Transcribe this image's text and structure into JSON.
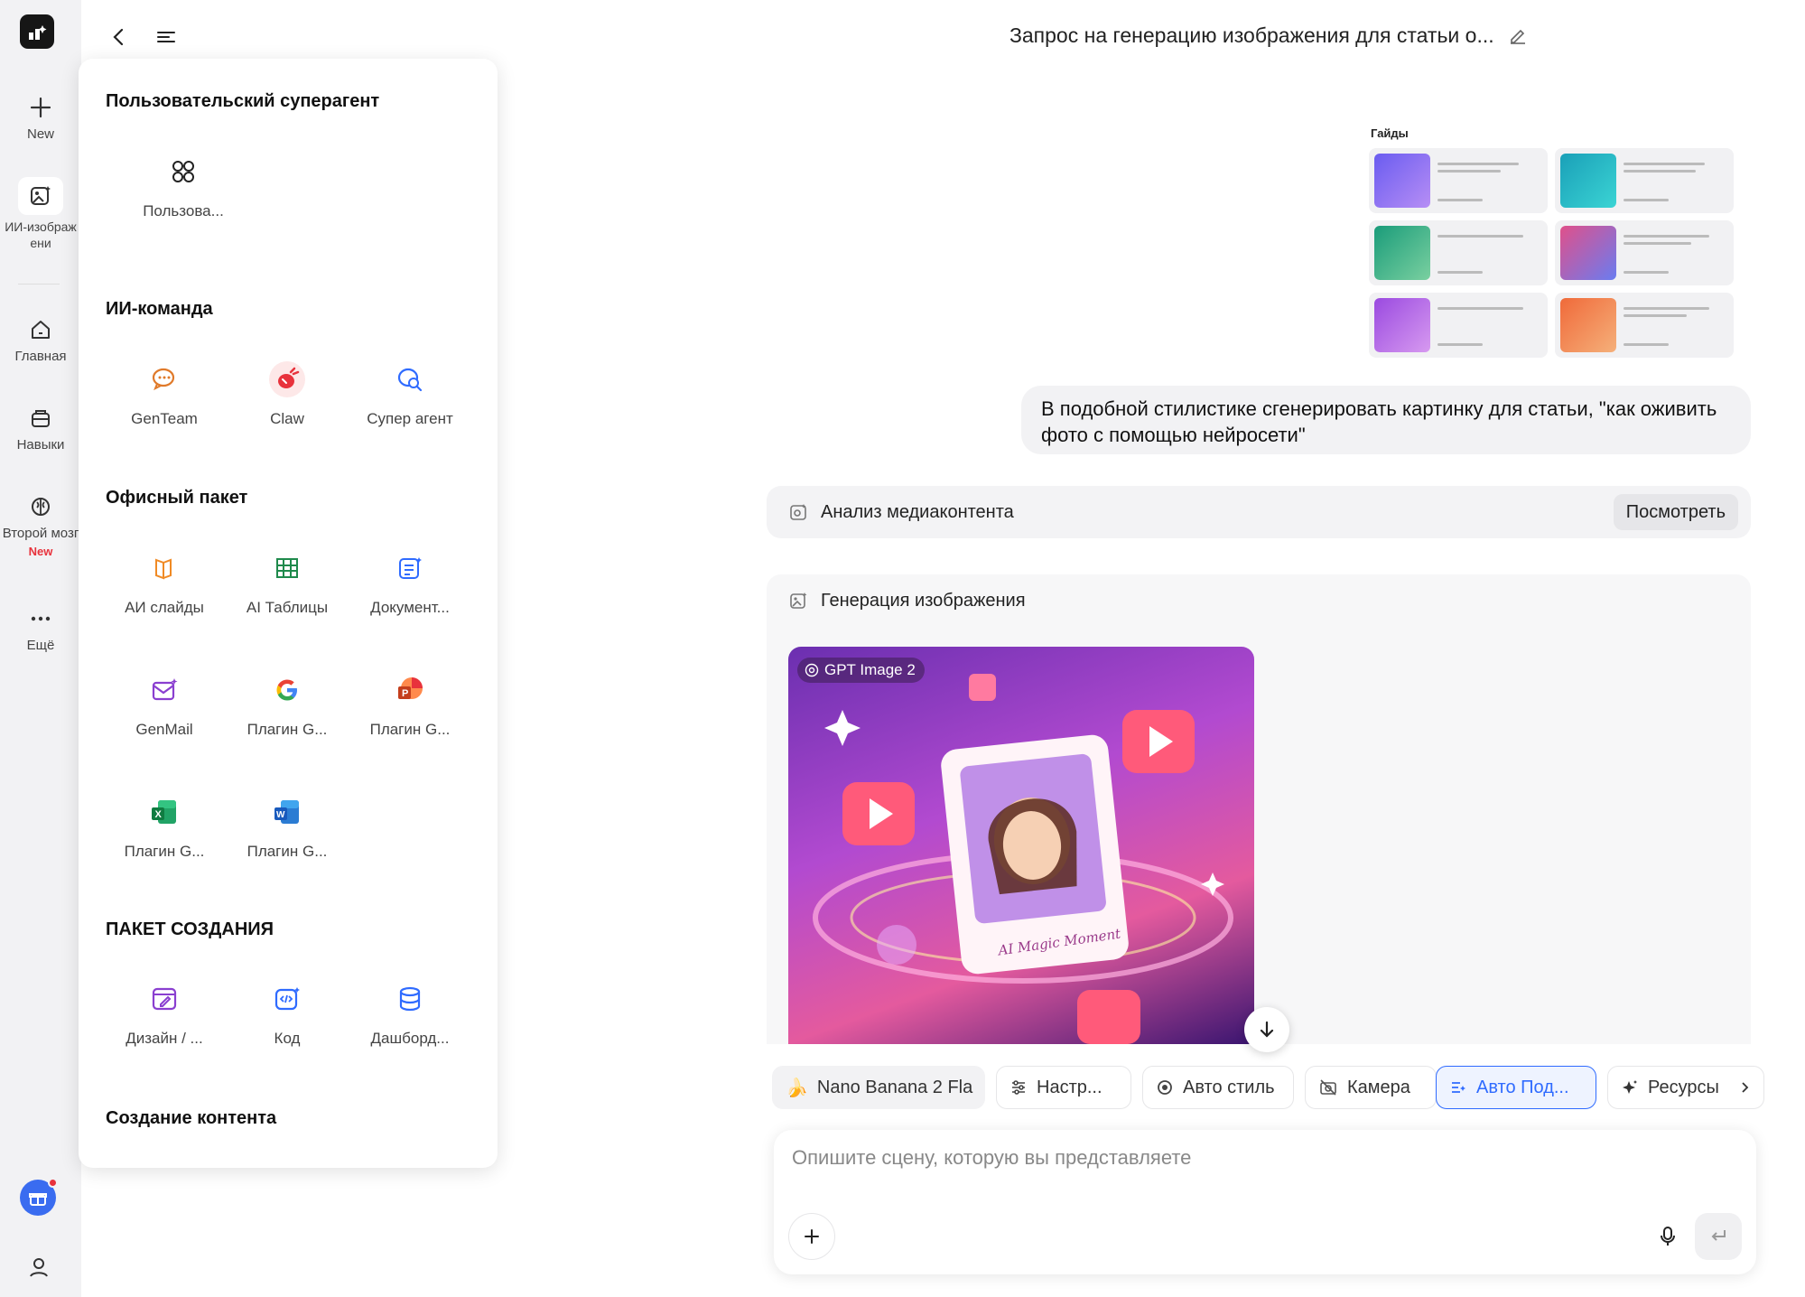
{
  "rail": {
    "items": [
      {
        "label": "New"
      },
      {
        "label": "ИИ-изображени"
      },
      {
        "label": "Главная"
      },
      {
        "label": "Навыки"
      },
      {
        "label": "Второй мозг",
        "badge": "New"
      },
      {
        "label": "Ещё"
      }
    ]
  },
  "header": {
    "title": "Запрос на генерацию изображения для статьи о..."
  },
  "panel": {
    "sections": [
      {
        "title": "Пользовательский суперагент",
        "apps": [
          {
            "label": "Пользова...",
            "icon": "grid-icon"
          }
        ]
      },
      {
        "title": "ИИ-команда",
        "apps": [
          {
            "label": "GenTeam",
            "icon": "chat-icon"
          },
          {
            "label": "Claw",
            "icon": "claw-icon"
          },
          {
            "label": "Супер агент",
            "icon": "search-chat-icon"
          }
        ]
      },
      {
        "title": "Офисный пакет",
        "apps": [
          {
            "label": "АИ слайды",
            "icon": "slides-icon"
          },
          {
            "label": "AI Таблицы",
            "icon": "table-icon"
          },
          {
            "label": "Документ...",
            "icon": "doc-icon"
          },
          {
            "label": "GenMail",
            "icon": "mail-icon"
          },
          {
            "label": "Плагин G...",
            "icon": "google-icon"
          },
          {
            "label": "Плагин G...",
            "icon": "powerpoint-icon"
          },
          {
            "label": "Плагин G...",
            "icon": "excel-icon"
          },
          {
            "label": "Плагин G...",
            "icon": "word-icon"
          }
        ]
      },
      {
        "title": "ПАКЕТ СОЗДАНИЯ",
        "apps": [
          {
            "label": "Дизайн / ...",
            "icon": "design-icon"
          },
          {
            "label": "Код",
            "icon": "code-icon"
          },
          {
            "label": "Дашборд...",
            "icon": "database-icon"
          }
        ]
      },
      {
        "title": "Создание контента",
        "apps": []
      }
    ]
  },
  "chat": {
    "guides_label": "Гайды",
    "user_message": "В подобной стилистике сгенерировать картинку для статьи, \"как оживить фото с помощью нейросети\"",
    "steps": [
      {
        "label": "Анализ медиаконтента",
        "action": "Посмотреть"
      },
      {
        "label": "Генерация изображения"
      }
    ],
    "image_badge": "GPT Image 2",
    "image_caption": "AI Magic Moment"
  },
  "toolbar": {
    "chips": [
      {
        "label": "Nano Banana 2 Fla",
        "icon": "banana-icon"
      },
      {
        "label": "Настр...",
        "icon": "sliders-icon"
      },
      {
        "label": "Авто стиль",
        "icon": "style-icon"
      },
      {
        "label": "Камера",
        "icon": "camera-off-icon"
      },
      {
        "label": "Авто Под...",
        "icon": "auto-prompt-icon",
        "active": true
      },
      {
        "label": "Ресурсы",
        "icon": "sparkle-icon"
      }
    ]
  },
  "input": {
    "placeholder": "Опишите сцену, которую вы представляете",
    "value": ""
  },
  "colors": {
    "accent": "#2f6bff",
    "danger": "#e8323c",
    "rail_bg": "#f2f2f4"
  }
}
